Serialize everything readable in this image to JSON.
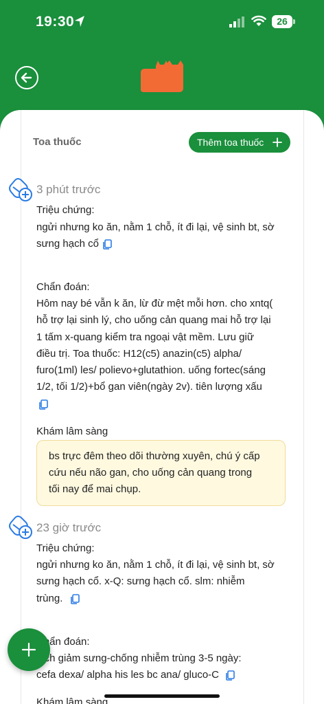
{
  "status_bar": {
    "time": "19:30",
    "battery": "26"
  },
  "colors": {
    "brand_green": "#1a8f3c",
    "logo_orange": "#f26b35",
    "note_bg": "#fff9e0"
  },
  "section": {
    "title": "Toa thuốc",
    "add_button_label": "Thêm toa thuốc"
  },
  "records": [
    {
      "time_ago": "3 phút trước",
      "symptoms_label": "Triệu chứng:",
      "symptoms_lines": [
        "ngửi nhưng ko ăn, nằm 1 chỗ, ít đi lại, vệ sinh bt, sờ",
        "sưng hạch cổ"
      ],
      "diagnosis_label": "Chẩn đoán:",
      "diagnosis_lines": [
        "Hôm nay bé vẫn k ăn, lừ đừ mệt mỗi hơn. cho xntq(",
        "hỗ trợ lại sinh lý, cho uống cản quang mai hỗ trợ lại",
        "1 tấm x-quang kiểm tra ngoại vật mềm. Lưu giữ",
        "điều trị. Toa thuốc: H12(c5) anazin(c5) alpha/",
        "furo(1ml) les/ polievo+glutathion. uống fortec(sáng",
        "1/2, tối 1/2)+bổ gan viên(ngày 2v). tiên lượng xấu"
      ],
      "exam_label": "Khám lâm sàng",
      "exam_lines": [
        "bs trực đêm theo dõi thường xuyên, chú ý cấp",
        "cứu nếu não gan, cho uống cản quang trong",
        "tối nay để mai chụp."
      ]
    },
    {
      "time_ago": "23 giờ trước",
      "symptoms_label": "Triệu chứng:",
      "symptoms_lines": [
        "ngửi nhưng ko ăn, nằm 1 chỗ, ít đi lại, vệ sinh bt, sờ",
        "sưng hạch cổ. x-Q: sưng hạch cổ. slm: nhiễm",
        "trùng."
      ],
      "diagnosis_label": "Chẩn đoán:",
      "diagnosis_lines": [
        "kích giảm sưng-chống nhiễm trùng 3-5 ngày:",
        "cefa dexa/ alpha his les bc ana/ gluco-C"
      ],
      "exam_label": "Khám lâm sàng"
    }
  ]
}
